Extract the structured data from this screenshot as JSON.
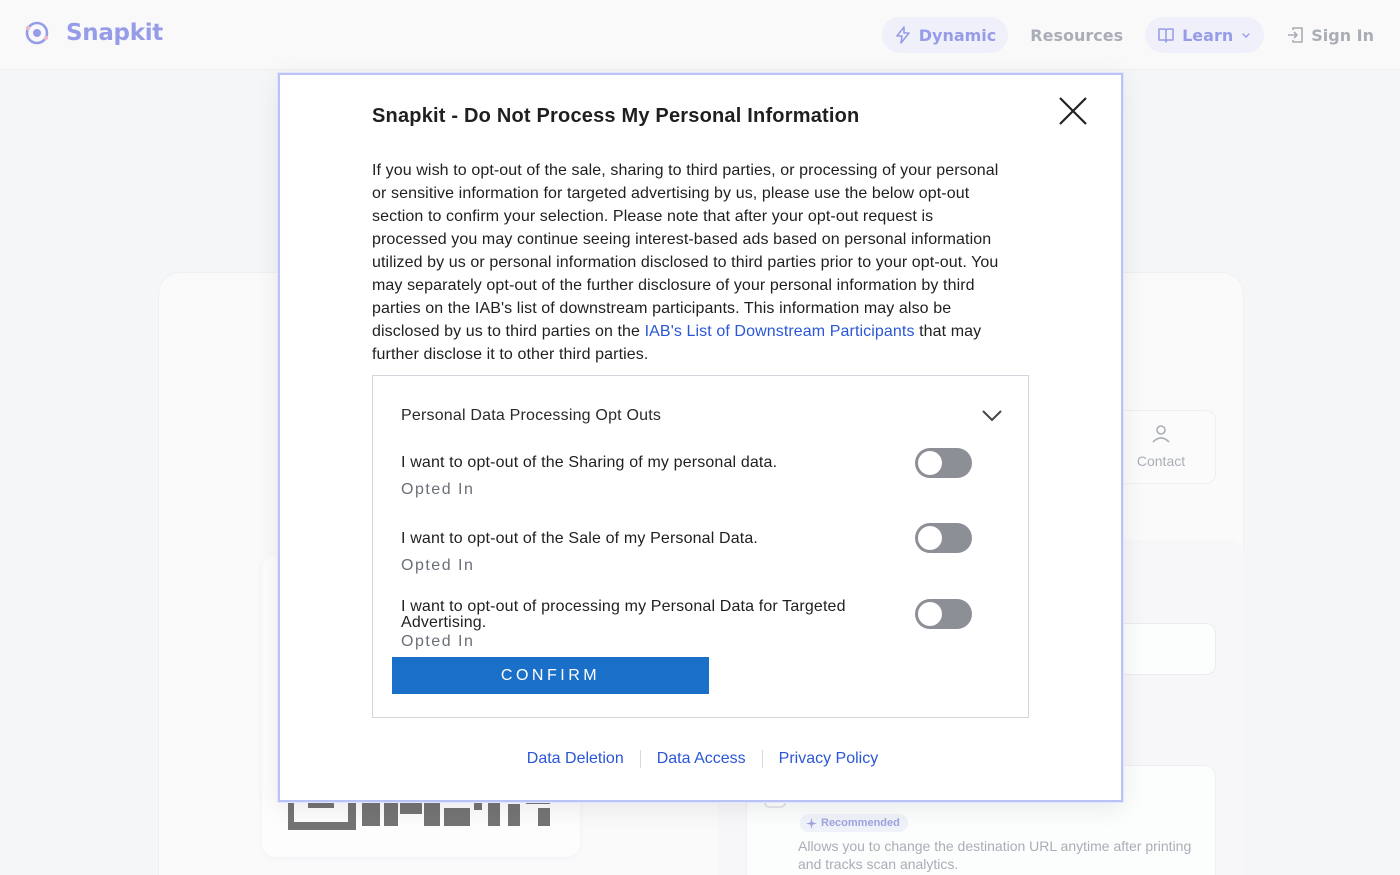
{
  "nav": {
    "brand": "Snapkit",
    "dynamic_label": "Dynamic",
    "resources_label": "Resources",
    "learn_label": "Learn",
    "signin_label": "Sign In",
    "accent": "#4a55d8"
  },
  "background": {
    "contact_label": "Contact",
    "recommended_badge": "Recommended",
    "recommended_desc": "Allows you to change the destination URL anytime after printing and tracks scan analytics."
  },
  "modal": {
    "title": "Snapkit - Do Not Process My Personal Information",
    "body_text": "If you wish to opt-out of the sale, sharing to third parties, or processing of your personal or sensitive information for targeted advertising by us, please use the below opt-out section to confirm your selection. Please note that after your opt-out request is processed you may continue seeing interest-based ads based on personal information utilized by us or personal information disclosed to third parties prior to your opt-out. You may separately opt-out of the further disclosure of your personal information by third parties on the IAB's list of downstream participants. This information may also be disclosed by us to third parties on the",
    "body_link": "IAB's List of Downstream Participants",
    "body_tail": "that may further disclose it to other third parties.",
    "panel_title": "Personal Data Processing Opt Outs",
    "options": [
      {
        "label": "I want to opt-out of the Sharing of my personal data.",
        "status": "Opted In"
      },
      {
        "label": "I want to opt-out of the Sale of my Personal Data.",
        "status": "Opted In"
      },
      {
        "label": "I want to opt-out of processing my Personal Data for Targeted Advertising.",
        "status": "Opted In"
      }
    ],
    "confirm_label": "CONFIRM",
    "footer_links": [
      "Data Deletion",
      "Data Access",
      "Privacy Policy"
    ],
    "link_color": "#2b56d6",
    "button_color": "#1a6fc8"
  }
}
